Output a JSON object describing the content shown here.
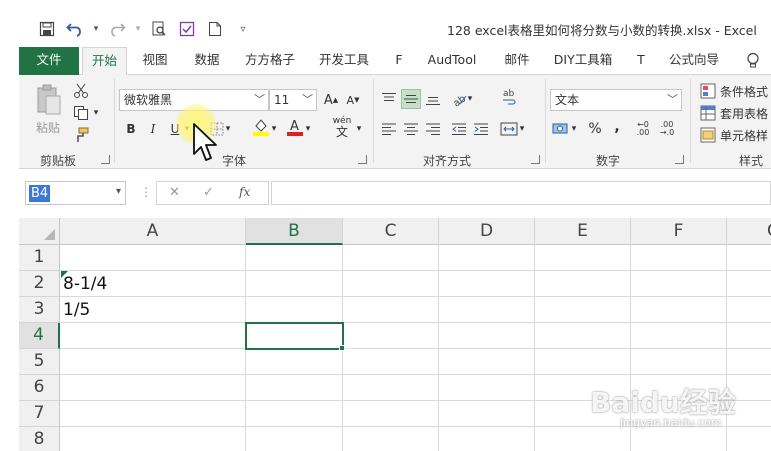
{
  "window": {
    "title": "128 excel表格里如何将分数与小数的转换.xlsx  -  Excel"
  },
  "quick_access": [
    {
      "icon": "save-icon"
    },
    {
      "icon": "undo-icon"
    },
    {
      "icon": "redo-icon"
    },
    {
      "icon": "print-preview-icon"
    },
    {
      "icon": "form-icon"
    },
    {
      "icon": "new-document-icon"
    },
    {
      "icon": "customize-qat-icon"
    }
  ],
  "tabs": [
    "文件",
    "开始",
    "视图",
    "数据",
    "方方格子",
    "开发工具",
    "F",
    "AudTool",
    "邮件",
    "DIY工具箱",
    "T",
    "公式向导"
  ],
  "active_tab": "开始",
  "ribbon": {
    "clipboard": {
      "label": "剪贴板",
      "paste": "粘贴"
    },
    "font": {
      "label": "字体",
      "font_name": "微软雅黑",
      "font_size": "11",
      "phonetic": "wén"
    },
    "alignment": {
      "label": "对齐方式"
    },
    "number": {
      "label": "数字",
      "format": "文本"
    },
    "styles": {
      "label": "样式",
      "conditional": "条件格式",
      "table": "套用表格",
      "cell_styles": "单元格样"
    }
  },
  "formula_bar": {
    "name_box": "B4",
    "formula": "",
    "fx": "fx"
  },
  "grid": {
    "columns": [
      "A",
      "B",
      "C",
      "D",
      "E",
      "F",
      "G"
    ],
    "selected_column": "B",
    "rows": [
      "1",
      "2",
      "3",
      "4",
      "5",
      "6",
      "7",
      "8"
    ],
    "selected_row": "4",
    "cells": [
      {
        "ref": "A2",
        "value": "8-1/4"
      },
      {
        "ref": "A3",
        "value": "1/5"
      }
    ],
    "selected_cell": "B4"
  },
  "colors": {
    "accent": "#217346",
    "selection": "#3c78d8"
  },
  "watermark": {
    "main": "Baidu经验",
    "sub": "jingyan.baidu.com"
  }
}
